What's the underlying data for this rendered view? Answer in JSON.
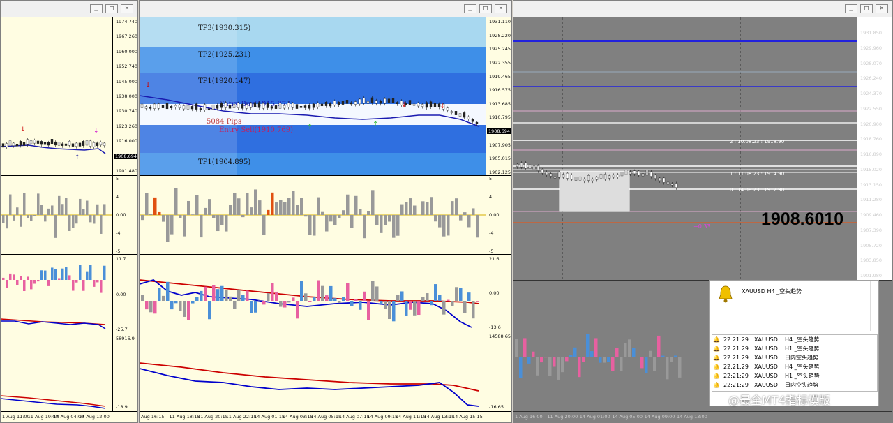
{
  "windows": {
    "left": {
      "buttons": [
        "_",
        "□",
        "✕"
      ],
      "price_axis": [
        "1974.740",
        "1967.260",
        "1960.000",
        "1952.740",
        "1945.000",
        "1938.000",
        "1930.740",
        "1923.260",
        "1916.000",
        "1908.694",
        "1901.480"
      ],
      "current_price": "1908.694",
      "macd_axis": [
        "5",
        "4",
        "0.00",
        "-4",
        "-5"
      ],
      "osc_axis": [
        "11.7",
        "0.00",
        "-25.7"
      ],
      "vol_axis": [
        "58916.9",
        "-18.9"
      ],
      "time_axis": [
        "1 Aug 11:00",
        "11 Aug 19:00",
        "14 Aug 04:00",
        "14 Aug 12:00"
      ]
    },
    "middle": {
      "buttons": [
        "_",
        "□",
        "✕"
      ],
      "zones": {
        "tp3": "TP3(1930.315)",
        "tp2": "TP2(1925.231)",
        "tp1_up": "TP1(1920.147)",
        "entry_buy": "Entry  Buy(1915.878)",
        "pips": "5084 Pips",
        "entry_sell": "Entry  Sell(1910.769)",
        "tp1_down": "TP1(1904.895)"
      },
      "price_axis": [
        "1931.110",
        "1928.220",
        "1925.245",
        "1922.355",
        "1919.465",
        "1916.575",
        "1913.685",
        "1910.795",
        "1908.694",
        "1907.905",
        "1905.015",
        "1902.125"
      ],
      "current_price": "1908.694",
      "macd_axis": [
        "5",
        "4",
        "0.00",
        "-4",
        "-5"
      ],
      "osc_axis": [
        "21.6",
        "0.00",
        "-13.6"
      ],
      "vol_axis": [
        "14588.65",
        "-16.65"
      ],
      "time_axis": [
        "Aug 16:15",
        "11 Aug 18:15",
        "11 Aug 20:15",
        "11 Aug 22:15",
        "14 Aug 01:15",
        "14 Aug 03:15",
        "14 Aug 05:15",
        "14 Aug 07:15",
        "14 Aug 09:15",
        "14 Aug 11:15",
        "14 Aug 13:15",
        "14 Aug 15:15"
      ]
    },
    "right": {
      "buttons": [
        "_",
        "□",
        "✕"
      ],
      "price_axis": [
        "1931.850",
        "1929.960",
        "1928.070",
        "1926.240",
        "1924.370",
        "1922.550",
        "1920.900",
        "1918.760",
        "1916.890",
        "1915.020",
        "1913.150",
        "1911.280",
        "1909.460",
        "1907.390",
        "1905.720",
        "1903.850",
        "1901.980"
      ],
      "big_price": "1908.6010",
      "mini_price": "+0.33",
      "levels": [
        "2 : 10.08.23 : 1918.90",
        "1 : 11.08.23 : 1914.90",
        "0 : 14.08.23 : 1912.90"
      ],
      "time_axis": [
        "1 Aug 16:00",
        "11 Aug 20:00",
        "14 Aug 01:00",
        "14 Aug 05:00",
        "14 Aug 09:00",
        "14 Aug 13:00"
      ]
    }
  },
  "alert": {
    "headline": "XAUUSD  H4 _空头趋势",
    "rows": [
      {
        "time": "22:21:29",
        "sym": "XAUUSD",
        "msg": "H4 _空头趋势"
      },
      {
        "time": "22:21:29",
        "sym": "XAUUSD",
        "msg": "H1 _空头趋势"
      },
      {
        "time": "22:21:29",
        "sym": "XAUUSD",
        "msg": "日内空头趋势"
      },
      {
        "time": "22:21:29",
        "sym": "XAUUSD",
        "msg": "H4 _空头趋势"
      },
      {
        "time": "22:21:29",
        "sym": "XAUUSD",
        "msg": "H1 _空头趋势"
      },
      {
        "time": "22:21:29",
        "sym": "XAUUSD",
        "msg": "日内空头趋势"
      }
    ]
  },
  "watermark": "@最全MT4指标模版"
}
